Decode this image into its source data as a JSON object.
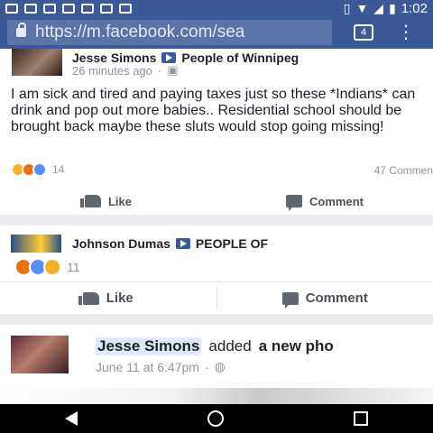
{
  "status_bar": {
    "time": "1:02",
    "left_icons": [
      "facebook-icon",
      "image-icon",
      "photo-icon",
      "gmail-icon",
      "settings-icon",
      "tools-icon",
      "send-icon"
    ],
    "right_icons": [
      "vibrate-icon",
      "wifi-icon",
      "signal-icon",
      "battery-icon"
    ]
  },
  "browser": {
    "url": "https://m.facebook.com/sea",
    "tabs_count": "4"
  },
  "posts": [
    {
      "author": "Jesse Simons",
      "group": "People of Winnipeg",
      "time": "26 minutes ago",
      "text": "I am sick and tired and paying taxes just so these *Indians* can drink and pop out more babies.. Residential school should be brought back maybe these sluts would stop going missing!",
      "reaction_count": "14",
      "comments": "47 Commen",
      "like_label": "Like",
      "comment_label": "Comment"
    },
    {
      "author": "Johnson Dumas",
      "group": "PEOPLE OF",
      "reaction_count": "11",
      "like_label": "Like",
      "comment_label": "Comment"
    },
    {
      "author": "Jesse Simons",
      "action": "added",
      "object": "a new pho",
      "time": "June 11 at 6:47pm"
    }
  ]
}
